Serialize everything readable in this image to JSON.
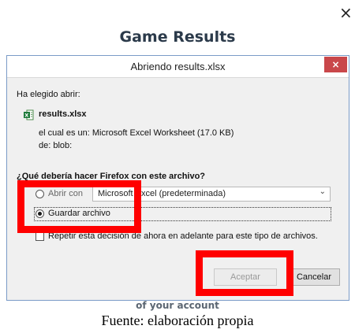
{
  "background": {
    "close_glyph": "×",
    "heading": "Game Results",
    "footer_text": "of your account"
  },
  "caption": "Fuente: elaboración propia",
  "dialog": {
    "title": "Abriendo results.xlsx",
    "close_glyph": "×",
    "intro": "Ha elegido abrir:",
    "file_name": "results.xlsx",
    "file_icon": "excel-file-icon",
    "type_line": "el cual es un:  Microsoft Excel Worksheet (17.0 KB)",
    "from_line": "de:  blob:",
    "question": "¿Qué debería hacer Firefox con este archivo?",
    "open_with_label": "Abrir con",
    "open_with_value": "Microsoft Excel (predeterminada)",
    "save_label": "Guardar archivo",
    "save_selected": true,
    "remember_label": "Repetir esta decisión de ahora en adelante para este tipo de archivos.",
    "remember_checked": false,
    "accept_label": "Aceptar",
    "cancel_label": "Cancelar"
  },
  "colors": {
    "highlight": "#ff0000",
    "close_button": "#c9474a",
    "heading": "#2b3a4a"
  }
}
